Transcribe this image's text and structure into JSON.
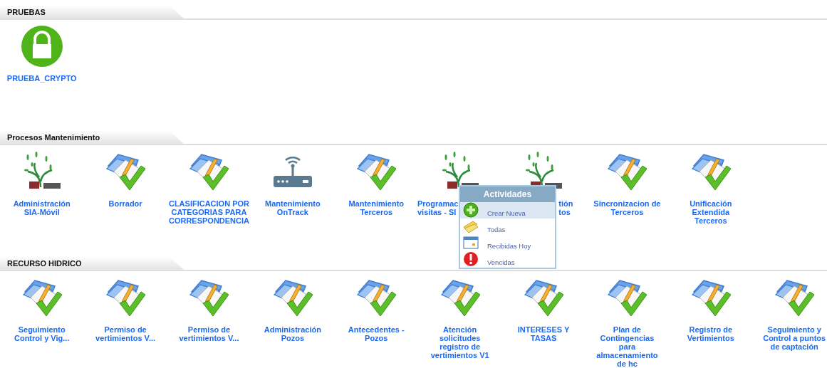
{
  "sections": [
    {
      "title": "PRUEBAS",
      "items": [
        {
          "kind": "lock",
          "label": "PRUEBA_CRYPTO"
        }
      ]
    },
    {
      "title": "Procesos Mantenimiento",
      "items": [
        {
          "kind": "sia-logo",
          "label": "Administración SIA-Móvil"
        },
        {
          "kind": "folder-check",
          "label": "Borrador"
        },
        {
          "kind": "folder-check",
          "label": "CLASIFICACION POR CATEGORIAS PARA CORRESPONDENCIA"
        },
        {
          "kind": "router",
          "label": "Mantenimiento OnTrack"
        },
        {
          "kind": "folder-check",
          "label": "Mantenimiento Terceros"
        },
        {
          "kind": "sia-logo",
          "label": "Programac\nvisitas - SI"
        },
        {
          "kind": "sia-logo",
          "label": "tión\ntos"
        },
        {
          "kind": "folder-check",
          "label": "Sincronizacion de Terceros"
        },
        {
          "kind": "folder-check",
          "label": "Unificación Extendida Terceros"
        }
      ],
      "popup": {
        "title": "Actividades",
        "items": [
          {
            "label": "Crear Nueva",
            "selected": true
          },
          {
            "label": "Todas",
            "selected": false
          },
          {
            "label": "Recibidas Hoy",
            "selected": false
          },
          {
            "label": "Vencidas",
            "selected": false
          }
        ]
      }
    },
    {
      "title": "RECURSO HIDRICO",
      "items": [
        {
          "kind": "folder-check",
          "label": "Seguimiento Control y Vig..."
        },
        {
          "kind": "folder-check",
          "label": "Permiso de vertimientos V..."
        },
        {
          "kind": "folder-check",
          "label": "Permiso de vertimientos V..."
        },
        {
          "kind": "folder-check",
          "label": "Administración Pozos"
        },
        {
          "kind": "folder-check",
          "label": "Antecedentes - Pozos"
        },
        {
          "kind": "folder-check",
          "label": "Atención solicitudes registro de vertimientos V1"
        },
        {
          "kind": "folder-check",
          "label": "INTERESES Y TASAS"
        },
        {
          "kind": "folder-check",
          "label": "Plan de Contingencias para almacenamiento de hc"
        },
        {
          "kind": "folder-check",
          "label": "Registro de Vertimientos"
        },
        {
          "kind": "folder-check",
          "label": "Seguimiento y Control a puntos de captación"
        }
      ]
    }
  ]
}
